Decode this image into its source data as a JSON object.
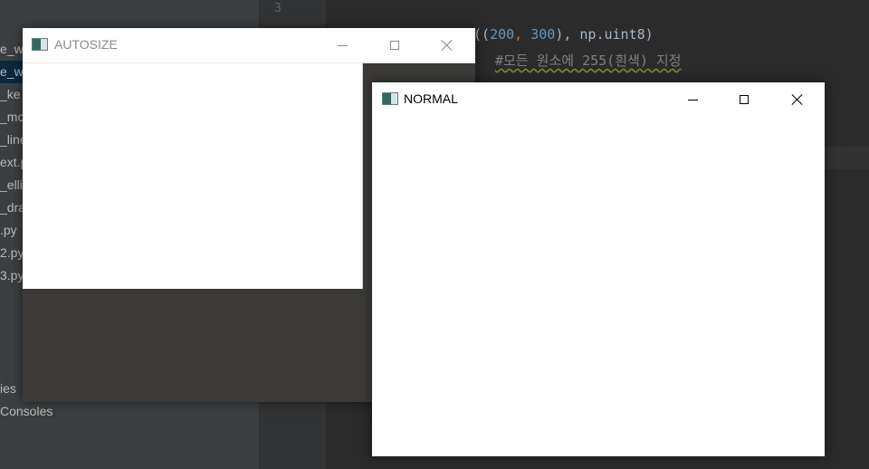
{
  "ide": {
    "sidebar_items": [
      {
        "label": "e_wi"
      },
      {
        "label": "e_w"
      },
      {
        "label": "_ke"
      },
      {
        "label": "_mo"
      },
      {
        "label": "_line"
      },
      {
        "label": "ext.p"
      },
      {
        "label": "_elli"
      },
      {
        "label": "_dra"
      },
      {
        "label": ".py"
      },
      {
        "label": "2.py"
      },
      {
        "label": "3.py"
      },
      {
        "label": "ies"
      },
      {
        "label": "Consoles"
      }
    ],
    "line_number": "3",
    "code_line_1": {
      "open": "((",
      "n1": "200",
      "comma1": ",",
      "n2": " 300",
      "close": "),",
      "rest": " np.uint8)"
    },
    "code_line_2": "#모든 원소에 255(흰색) 지정"
  },
  "windows": {
    "autosize": {
      "title": "AUTOSIZE"
    },
    "normal": {
      "title": "NORMAL"
    }
  },
  "colors": {
    "ide_background": "#2b2b2b",
    "sidebar_background": "#3c3f41",
    "window_background": "#ffffff",
    "autosize_filler": "#3b3a39"
  },
  "icons": {
    "window_app": "app-window-icon",
    "minimize": "minimize-icon",
    "maximize": "maximize-icon",
    "close": "close-icon"
  }
}
